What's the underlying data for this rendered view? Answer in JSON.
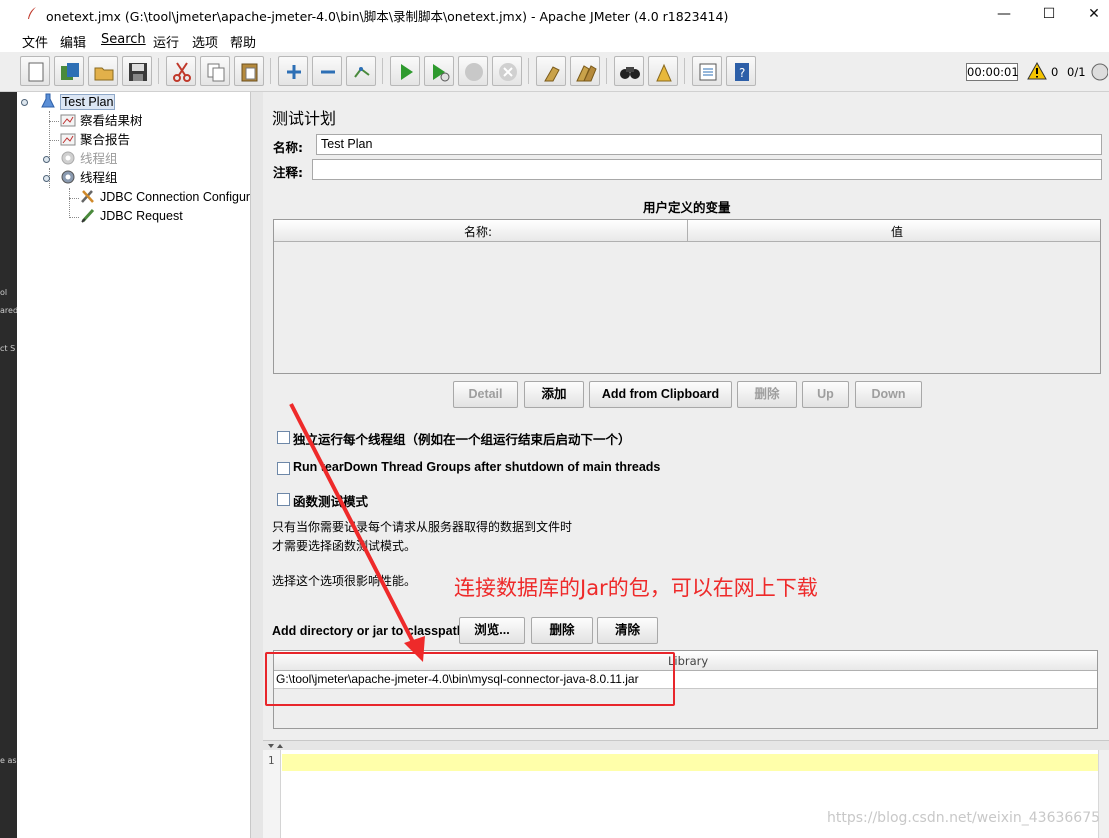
{
  "window": {
    "title": "onetext.jmx (G:\\tool\\jmeter\\apache-jmeter-4.0\\bin\\脚本\\录制脚本\\onetext.jmx) - Apache JMeter (4.0 r1823414)",
    "controls": {
      "minimize": "—",
      "maximize": "☐",
      "close": "✕"
    }
  },
  "menu": [
    "文件",
    "编辑",
    "Search",
    "运行",
    "选项",
    "帮助"
  ],
  "toolbar": {
    "buttons": [
      "new-icon",
      "templates-icon",
      "open-icon",
      "save-icon",
      "cut-icon",
      "copy-icon",
      "paste-icon",
      "expand-icon",
      "collapse-icon",
      "toggle-icon",
      "start-icon",
      "start-no-pause-icon",
      "stop-icon",
      "shutdown-icon",
      "clear-icon",
      "clear-all-icon",
      "search-icon",
      "reset-search-icon",
      "function-helper-icon",
      "help-icon"
    ],
    "timer": "00:00:01",
    "warnings": "0",
    "threads": "0/1"
  },
  "left_strip": [
    "ol",
    "ared",
    "ct S",
    "e as"
  ],
  "tree": {
    "nodes": [
      {
        "label": "Test Plan",
        "icon": "test-plan-icon",
        "selected": true,
        "disabled": false
      },
      {
        "label": "察看结果树",
        "icon": "listener-icon",
        "selected": false,
        "disabled": false
      },
      {
        "label": "聚合报告",
        "icon": "listener-icon",
        "selected": false,
        "disabled": false
      },
      {
        "label": "线程组",
        "icon": "thread-group-icon",
        "selected": false,
        "disabled": true
      },
      {
        "label": "线程组",
        "icon": "thread-group-icon",
        "selected": false,
        "disabled": false
      },
      {
        "label": "JDBC Connection Configur",
        "icon": "config-icon",
        "selected": false,
        "disabled": false
      },
      {
        "label": "JDBC Request",
        "icon": "sampler-icon",
        "selected": false,
        "disabled": false
      }
    ]
  },
  "panel": {
    "title": "测试计划",
    "name_label": "名称:",
    "name_value": "Test Plan",
    "comment_label": "注释:",
    "comment_value": "",
    "vars_title": "用户定义的变量",
    "vars_columns": [
      "名称:",
      "值"
    ],
    "buttons": {
      "detail": "Detail",
      "add": "添加",
      "add_clipboard": "Add from Clipboard",
      "delete": "删除",
      "up": "Up",
      "down": "Down"
    },
    "options": [
      {
        "label": "独立运行每个线程组（例如在一个组运行结束后启动下一个）",
        "checked": false
      },
      {
        "label": "Run tearDown Thread Groups after shutdown of main threads",
        "checked": false
      },
      {
        "label": "函数测试模式",
        "checked": false
      }
    ],
    "note_line1": "只有当你需要记录每个请求从服务器取得的数据到文件时",
    "note_line2": "才需要选择函数测试模式。",
    "note_line3": "选择这个选项很影响性能。",
    "annotation": "连接数据库的Jar的包，可以在网上下载",
    "classpath_label": "Add directory or jar to classpath",
    "classpath_buttons": {
      "browse": "浏览...",
      "delete": "删除",
      "clear": "清除"
    },
    "library_header": "Library",
    "library_rows": [
      "G:\\tool\\jmeter\\apache-jmeter-4.0\\bin\\mysql-connector-java-8.0.11.jar"
    ]
  },
  "log": {
    "line_number": "1",
    "watermark": "https://blog.csdn.net/weixin_43636675"
  },
  "colors": {
    "annotation_red": "#ee2a2a",
    "current_line": "#ffffaa",
    "selection": "#dce6f4"
  }
}
